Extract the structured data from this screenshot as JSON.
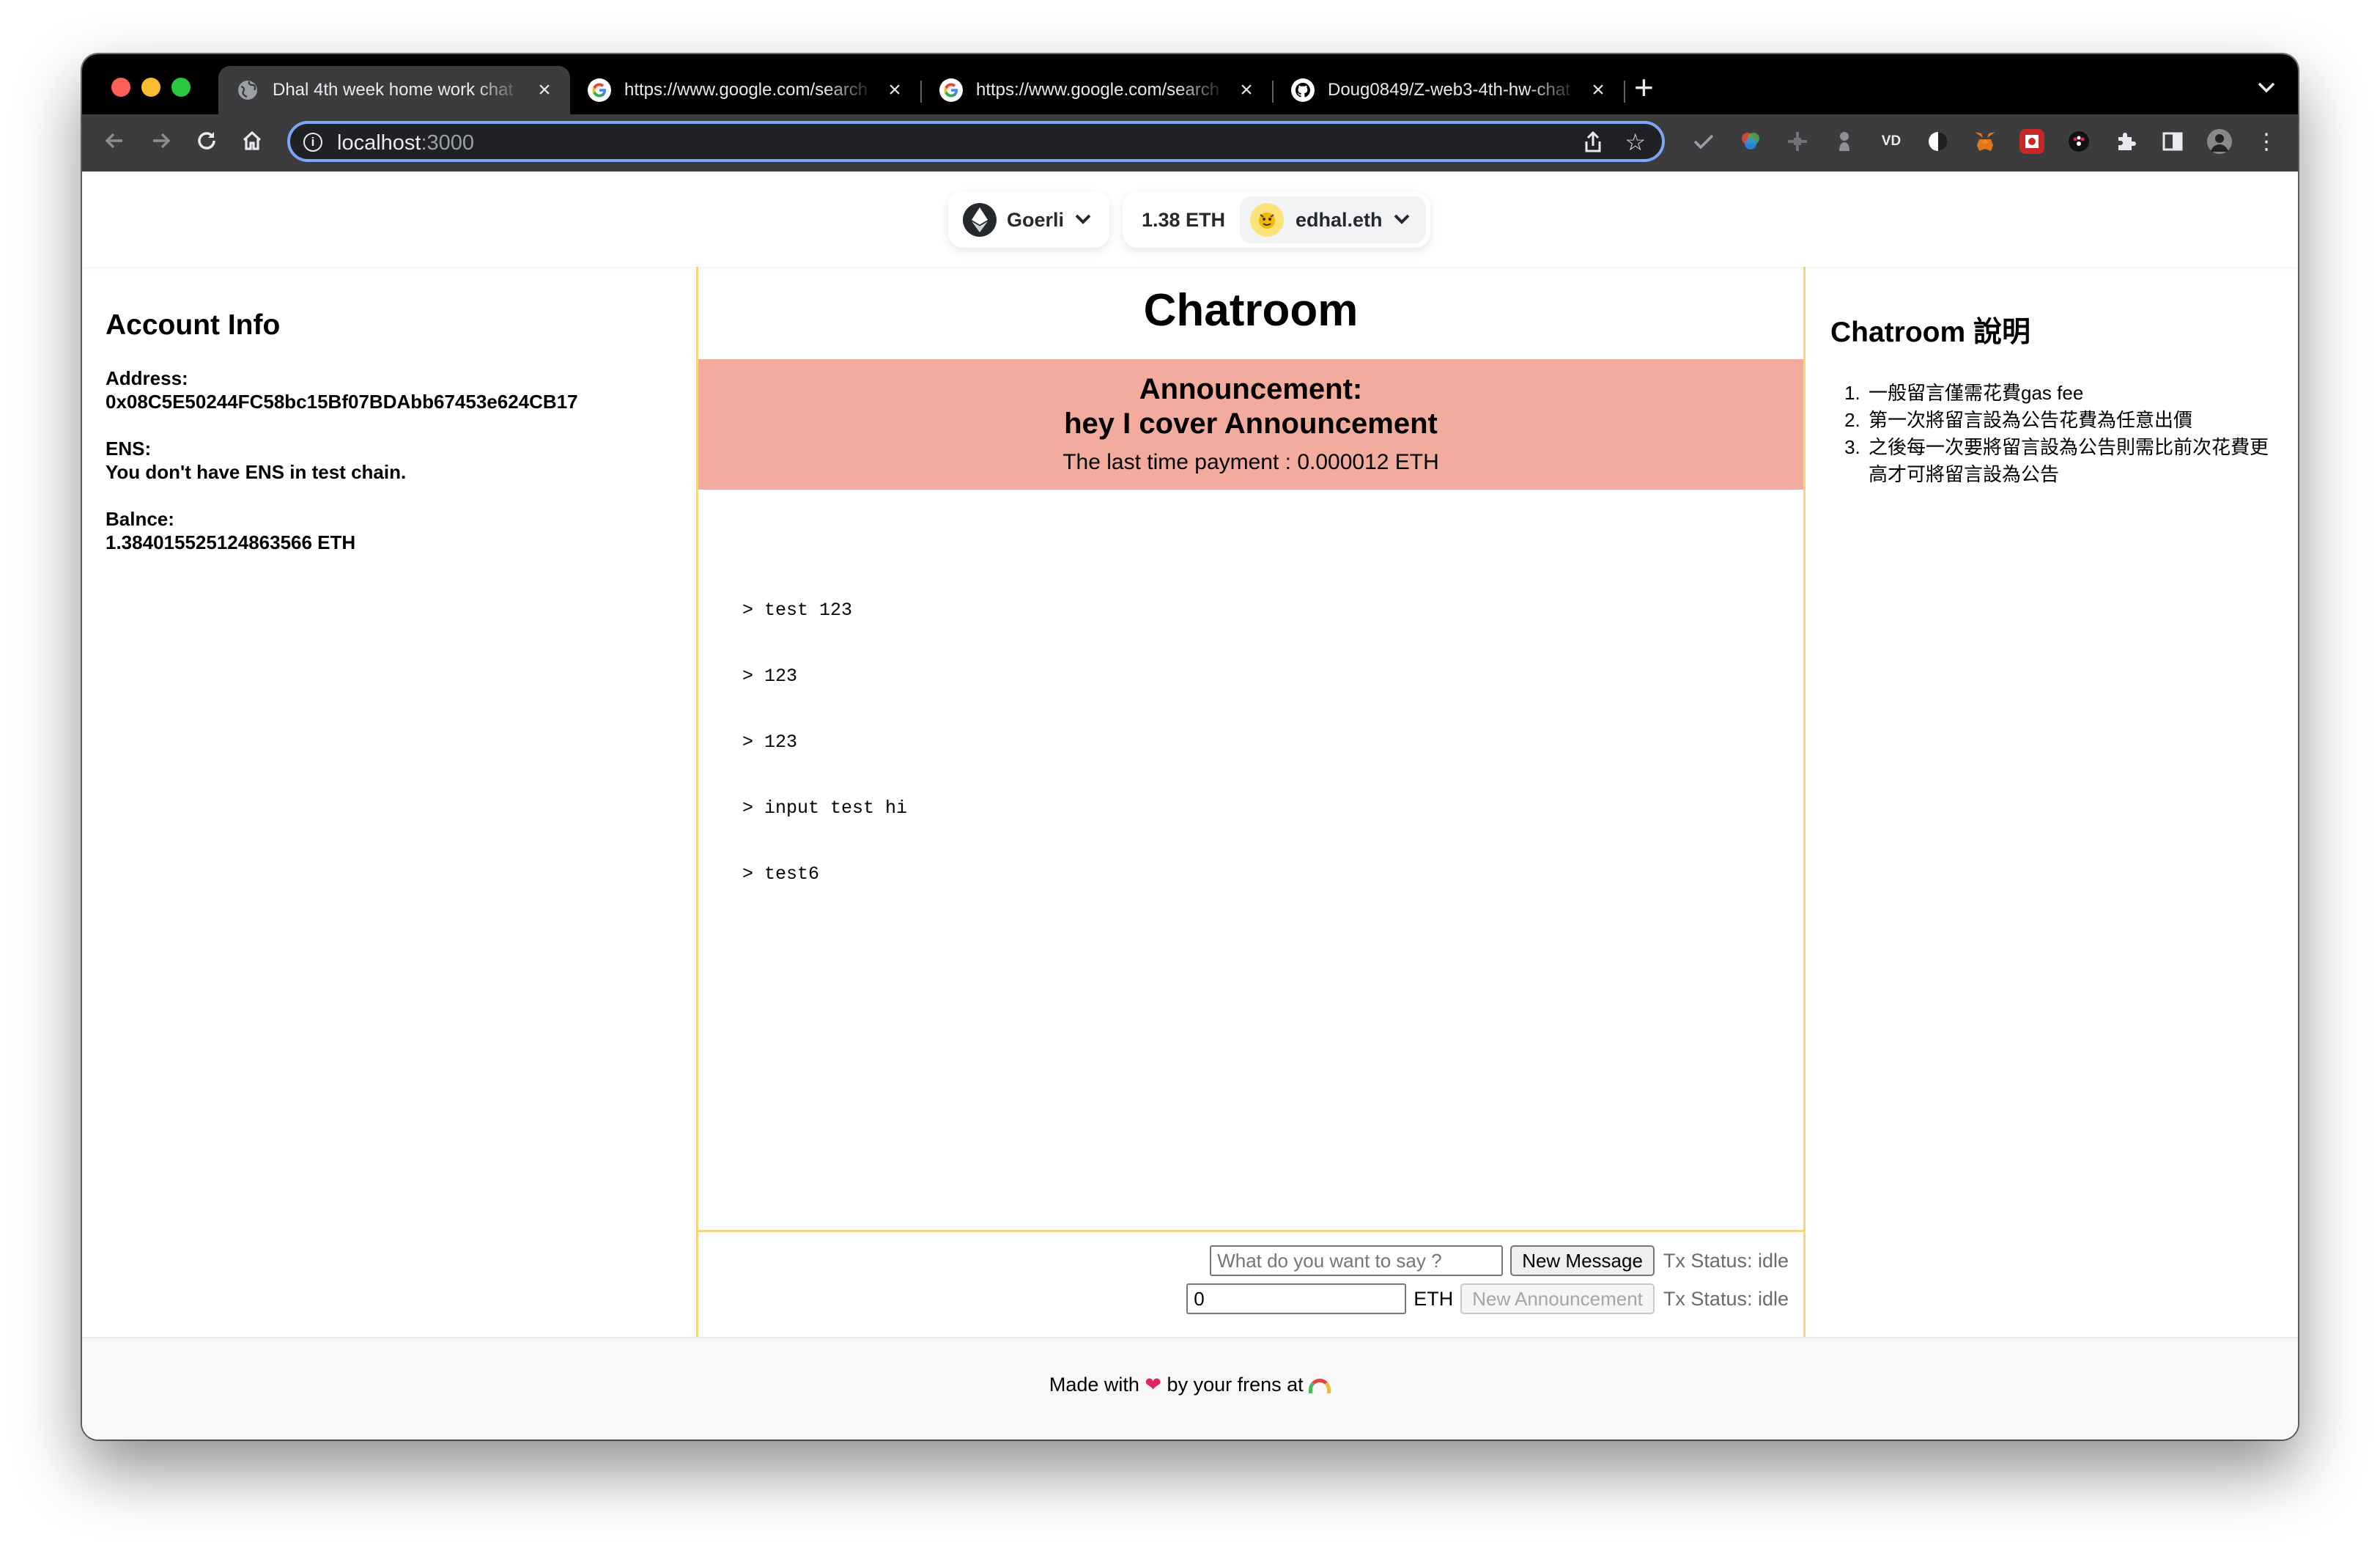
{
  "browser": {
    "tabs": [
      {
        "title": "Dhal 4th week home work chat",
        "favicon": "globe-icon",
        "active": true
      },
      {
        "title": "https://www.google.com/search",
        "favicon": "google-icon",
        "active": false
      },
      {
        "title": "https://www.google.com/search",
        "favicon": "google-icon",
        "active": false
      },
      {
        "title": "Doug0849/Z-web3-4th-hw-chat",
        "favicon": "github-icon",
        "active": false
      }
    ],
    "url_host": "localhost",
    "url_port": ":3000"
  },
  "wallet": {
    "chain": "Goerli",
    "balance": "1.38 ETH",
    "account": "edhal.eth"
  },
  "account_info": {
    "title": "Account Info",
    "address_label": "Address:",
    "address": "0x08C5E50244FC58bc15Bf07BDAbb67453e624CB17",
    "ens_label": "ENS:",
    "ens": "You don't have ENS in test chain.",
    "balance_label": "Balnce:",
    "balance": "1.384015525124863566 ETH"
  },
  "chatroom": {
    "title": "Chatroom",
    "announcement_heading": "Announcement:",
    "announcement_text": "hey I cover Announcement",
    "last_payment": "The last time payment : 0.000012 ETH",
    "messages": [
      "> test 123",
      "> 123",
      "> 123",
      "> input test hi",
      "> test6"
    ],
    "message_placeholder": "What do you want to say ?",
    "new_message_label": "New Message",
    "tx_status_1": "Tx Status: idle",
    "eth_amount": "0",
    "eth_unit": "ETH",
    "new_announcement_label": "New Announcement",
    "tx_status_2": "Tx Status: idle"
  },
  "rules": {
    "title": "Chatroom 說明",
    "items": [
      "一般留言僅需花費gas fee",
      "第一次將留言設為公告花費為任意出價",
      "之後每一次要將留言設為公告則需比前次花費更高才可將留言設為公告"
    ]
  },
  "footer": {
    "made_with": "Made with",
    "by_text": "by your frens at"
  },
  "colors": {
    "announcement_bg": "#f2ab9c",
    "column_border": "#f6d57c",
    "omnibox_focus": "#7ba6f7"
  }
}
